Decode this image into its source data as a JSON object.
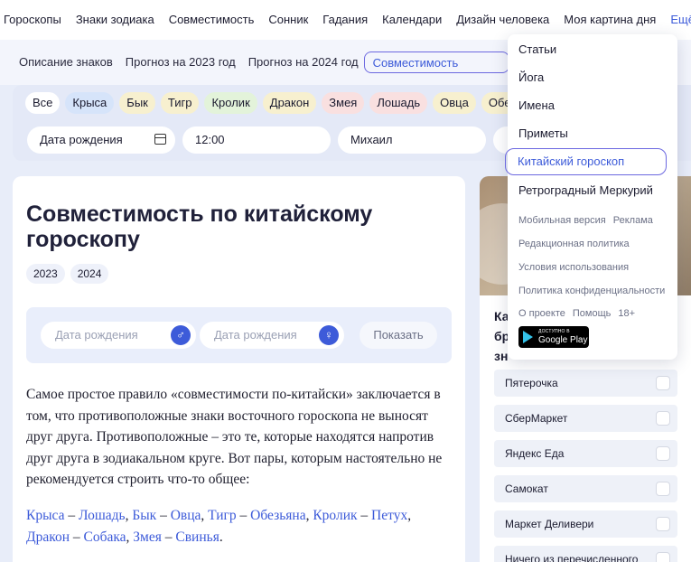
{
  "topnav": {
    "items": [
      "Гороскопы",
      "Знаки зодиака",
      "Совместимость",
      "Сонник",
      "Гадания",
      "Календари",
      "Дизайн человека",
      "Моя картина дня"
    ],
    "more": "Ещё"
  },
  "subnav": {
    "items": [
      "Описание знаков",
      "Прогноз на 2023 год",
      "Прогноз на 2024 год"
    ],
    "active": "Совместимость"
  },
  "filters": {
    "chips": [
      "Все",
      "Крыса",
      "Бык",
      "Тигр",
      "Кролик",
      "Дракон",
      "Змея",
      "Лошадь",
      "Овца",
      "Обезья..."
    ],
    "birth_date": "Дата рождения",
    "time": "12:00",
    "name": "Михаил"
  },
  "article": {
    "title": "Совместимость по китайскому гороскопу",
    "years": [
      "2023",
      "2024"
    ],
    "compat": {
      "birth_date_1": "Дата рождения",
      "birth_date_2": "Дата рождения",
      "male_symbol": "♂",
      "female_symbol": "♀",
      "show_label": "Показать"
    },
    "paragraph": "Самое простое правило «совместимости по-китайски» заключается в том, что противоположные знаки восточного гороскопа не выносят друг друга. Противоположные – это те, которые находятся напротив друг друга в зодиакальном круге. Вот пары, которым настоятельно не рекомендуется строить что-то общее:",
    "pairs": [
      [
        "Крыса",
        "Лошадь"
      ],
      [
        "Бык",
        "Овца"
      ],
      [
        "Тигр",
        "Обезьяна"
      ],
      [
        "Кролик",
        "Петух"
      ],
      [
        "Дракон",
        "Собака"
      ],
      [
        "Змея",
        "Свинья"
      ]
    ],
    "pair_sep": "–",
    "list_sep": ","
  },
  "poll": {
    "title_lines": [
      "Ка",
      "бр",
      "зн"
    ],
    "options": [
      "Пятерочка",
      "СберМаркет",
      "Яндекс Еда",
      "Самокат",
      "Маркет Деливери",
      "Ничего из перечисленного"
    ]
  },
  "dropdown": {
    "items": [
      "Статьи",
      "Йога",
      "Имена",
      "Приметы"
    ],
    "active": "Китайский гороскоп",
    "after": "Ретроградный Меркурий",
    "links_row1": [
      "Мобильная версия",
      "Реклама"
    ],
    "link_editorial": "Редакционная политика",
    "link_terms": "Условия использования",
    "link_privacy": "Политика конфиденциальности",
    "links_row2": [
      "О проекте",
      "Помощь",
      "18+"
    ],
    "gplay_small": "ДОСТУПНО В",
    "gplay_big": "Google Play"
  },
  "colors": {
    "accent": "#3d5bd9",
    "active_border": "#6c68e0",
    "page_bg": "#e8edf9"
  }
}
